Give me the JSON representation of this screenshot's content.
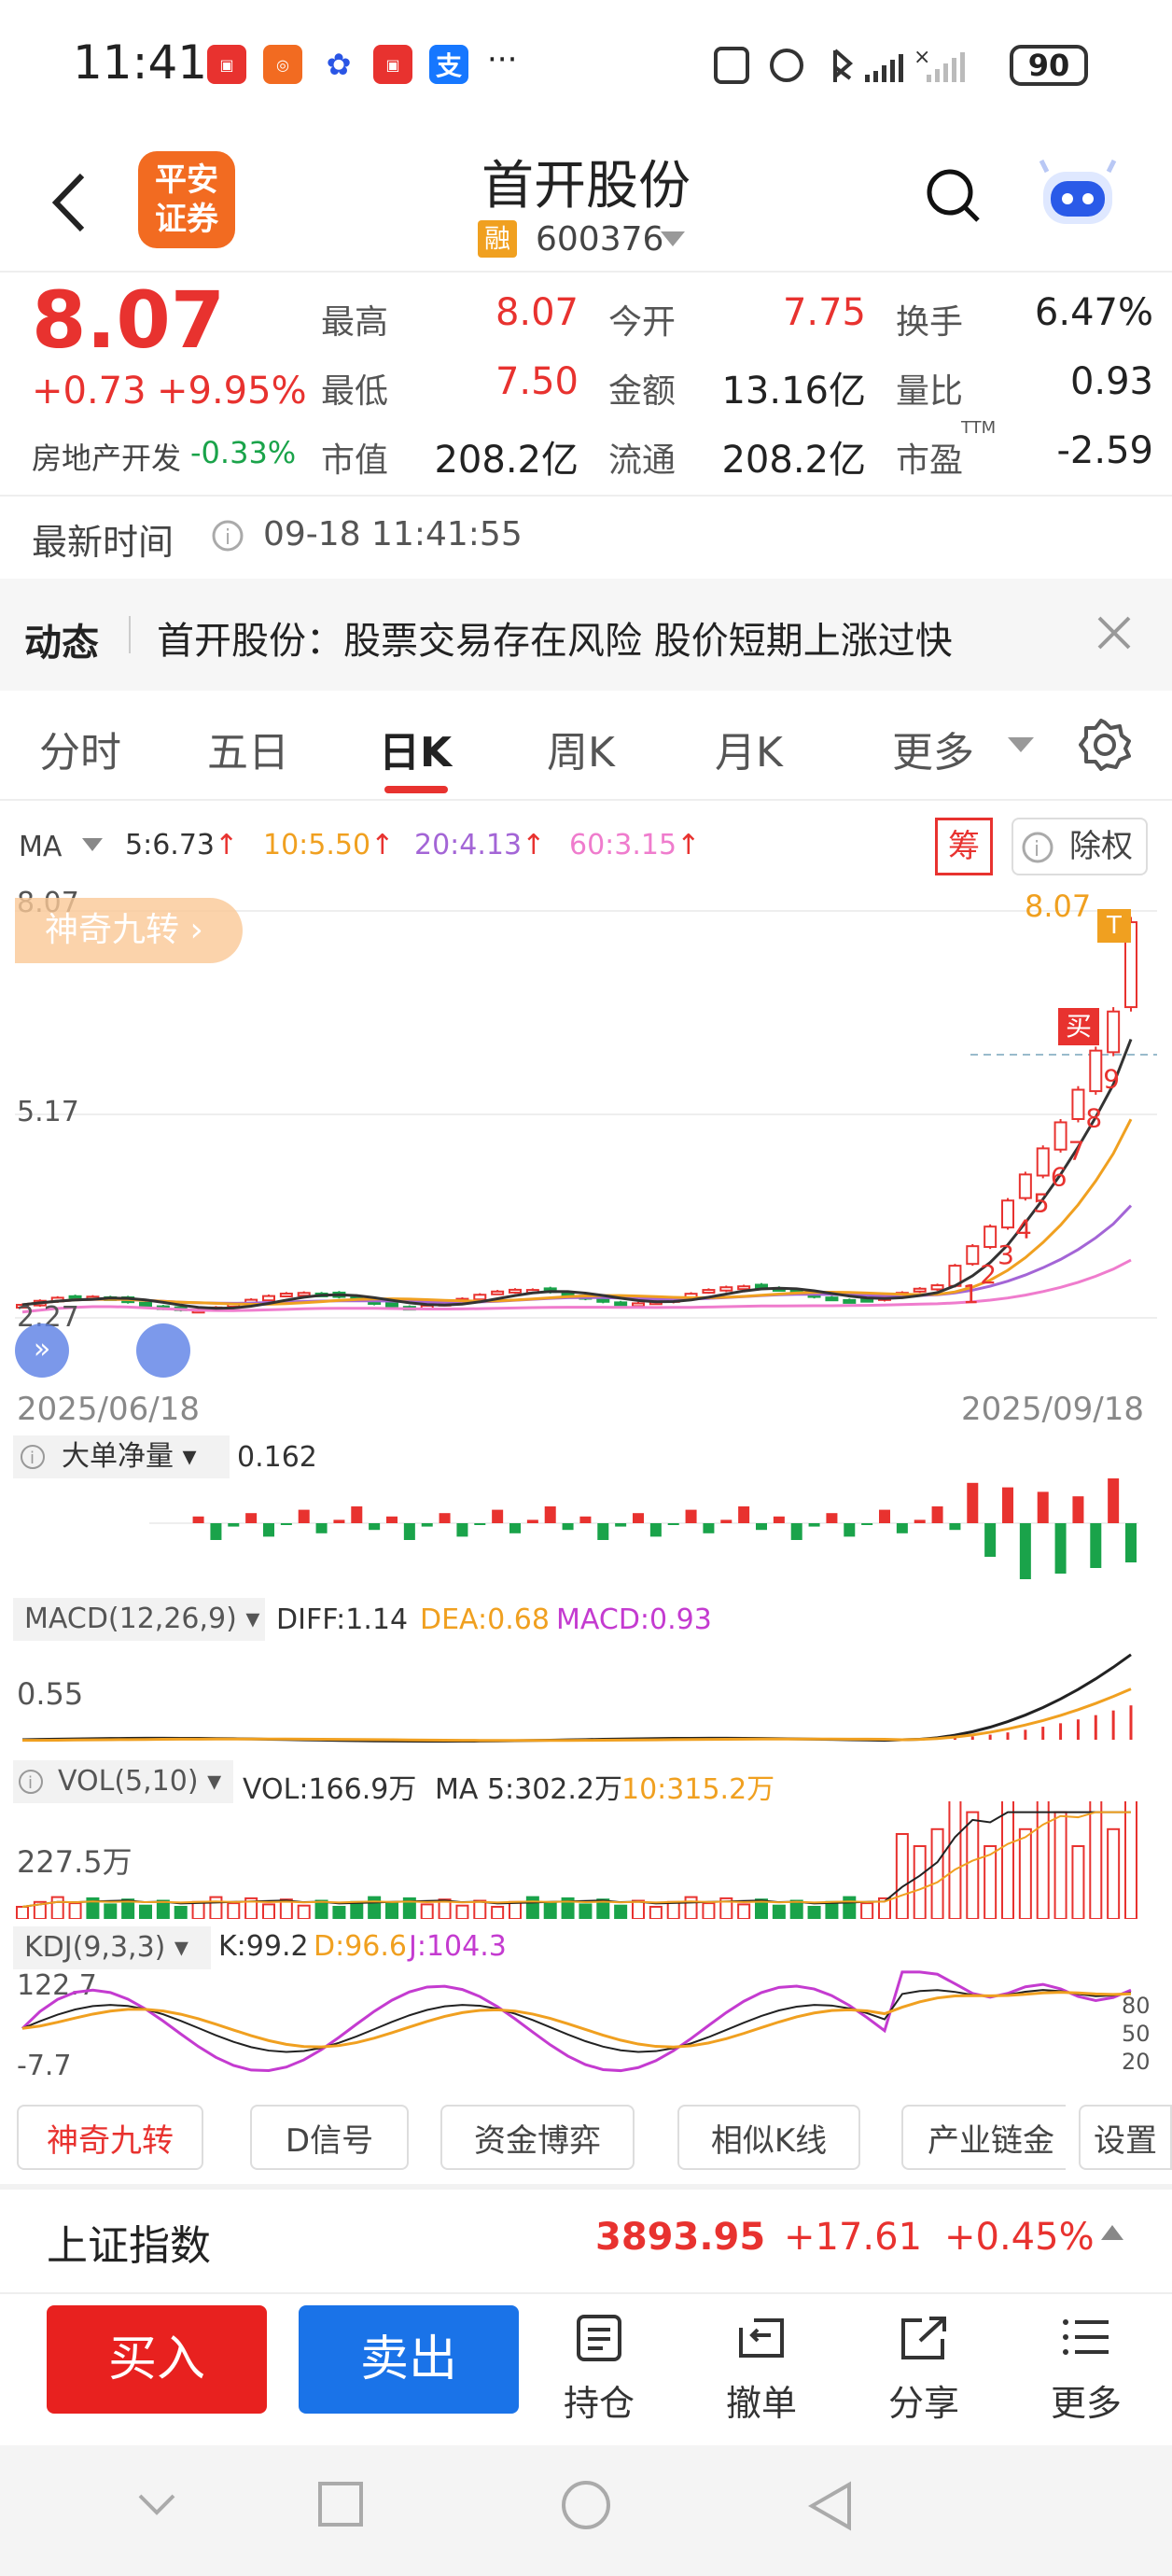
{
  "status_bar": {
    "time": "11:41",
    "more": "···",
    "battery": "90",
    "app_icons": [
      "huawei-store-icon",
      "app-grid-icon",
      "baidu-icon",
      "huawei-store-icon",
      "alipay-icon"
    ]
  },
  "header": {
    "broker_logo": "平安证券",
    "title": "首开股份",
    "tag": "融",
    "code": "600376"
  },
  "quote": {
    "price": "8.07",
    "change": "+0.73",
    "change_pct": "+9.95%",
    "sector": "房地产开发",
    "sector_pct": "-0.33%",
    "stats": [
      {
        "label": "最高",
        "value": "8.07",
        "color": "red"
      },
      {
        "label": "今开",
        "value": "7.75",
        "color": "red"
      },
      {
        "label": "换手",
        "value": "6.47%",
        "color": "dark"
      },
      {
        "label": "最低",
        "value": "7.50",
        "color": "red"
      },
      {
        "label": "金额",
        "value": "13.16亿",
        "color": "dark"
      },
      {
        "label": "量比",
        "value": "0.93",
        "color": "dark"
      },
      {
        "label": "市值",
        "value": "208.2亿",
        "color": "dark"
      },
      {
        "label": "流通",
        "value": "208.2亿",
        "color": "dark"
      },
      {
        "label": "市盈",
        "value": "-2.59",
        "color": "dark",
        "sup": "TTM"
      }
    ],
    "latest_time_label": "最新时间",
    "latest_time": "09-18 11:41:55"
  },
  "news": {
    "label": "动态",
    "text": "首开股份：股票交易存在风险 股价短期上涨过快"
  },
  "tabs": [
    {
      "label": "分时",
      "active": false
    },
    {
      "label": "五日",
      "active": false
    },
    {
      "label": "日K",
      "active": true
    },
    {
      "label": "周K",
      "active": false
    },
    {
      "label": "月K",
      "active": false
    },
    {
      "label": "更多",
      "active": false
    }
  ],
  "ma_legend": {
    "label": "MA",
    "ma5": "5:6.73",
    "ma10": "10:5.50",
    "ma20": "20:4.13",
    "ma60": "60:3.15",
    "chip_label": "筹",
    "fq_label": "除权"
  },
  "kline": {
    "badge": "神奇九转",
    "y_top": "8.07",
    "y_mid": "5.17",
    "y_low": "2.27",
    "last_price_label": "8.07",
    "start_date": "2025/06/18",
    "end_date": "2025/09/18",
    "buy_marker": "买",
    "sell_marker": "T",
    "nine_numbers": [
      "1",
      "2",
      "3",
      "4",
      "5",
      "6",
      "7",
      "8",
      "9"
    ]
  },
  "big_order": {
    "label": "大单净量",
    "value": "0.162"
  },
  "macd": {
    "label": "MACD(12,26,9)",
    "diff": "DIFF:1.14",
    "dea": "DEA:0.68",
    "macd": "MACD:0.93",
    "y_label": "0.55"
  },
  "vol": {
    "label": "VOL(5,10)",
    "vol": "VOL:166.9万",
    "ma5": "MA 5:302.2万",
    "ma10": "10:315.2万",
    "y_label": "227.5万"
  },
  "kdj": {
    "label": "KDJ(9,3,3)",
    "k": "K:99.2",
    "d": "D:96.6",
    "j": "J:104.3",
    "y_top": "122.7",
    "y_bottom": "-7.7",
    "levels": [
      "80",
      "50",
      "20"
    ]
  },
  "indicator_buttons": [
    "神奇九转",
    "D信号",
    "资金博弈",
    "相似K线",
    "产业链金"
  ],
  "settings_label": "设置",
  "index_bar": {
    "name": "上证指数",
    "value": "3893.95",
    "change": "+17.61",
    "pct": "+0.45%"
  },
  "toolbar": {
    "buy": "买入",
    "sell": "卖出",
    "position": "持仓",
    "cancel": "撤单",
    "share": "分享",
    "more": "更多"
  },
  "colors": {
    "up": "#e8322f",
    "down": "#1aa34a",
    "ma5": "#333333",
    "ma10": "#f0a020",
    "ma20": "#a365d6",
    "ma60": "#ef7ccd",
    "sell_blue": "#1a73e8",
    "logo_orange": "#f26b21"
  }
}
